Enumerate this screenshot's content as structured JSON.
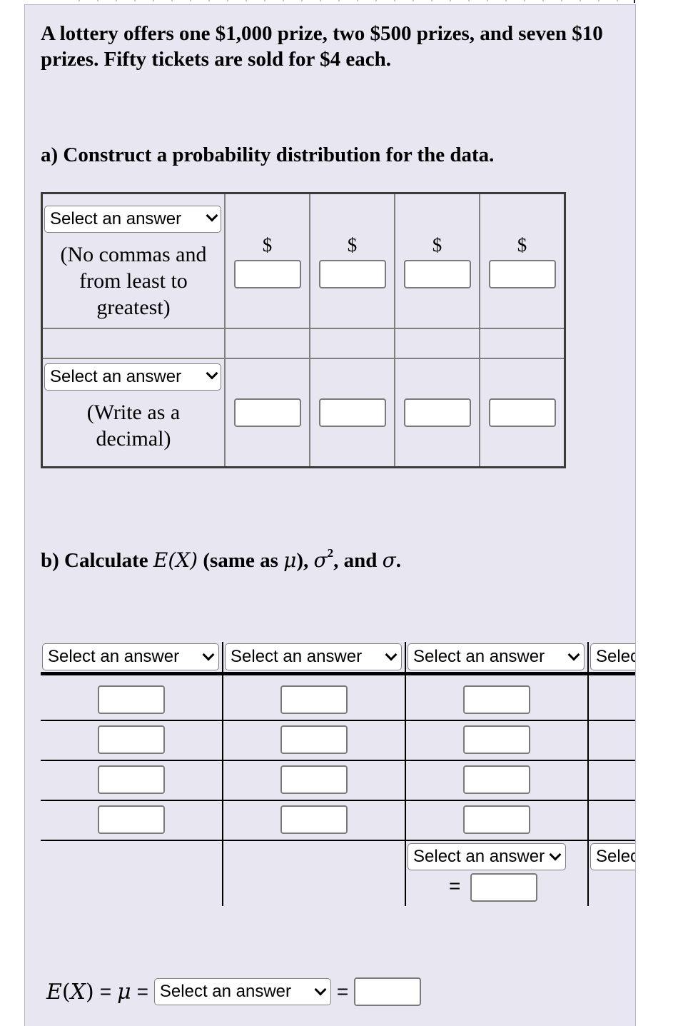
{
  "question": {
    "text": "A lottery offers one $1,000 prize, two $500 prizes, and seven $10 prizes. Fifty tickets are sold for $4 each.",
    "part_a": "a) Construct a probability distribution for the data.",
    "part_b": {
      "prefix": "b) Calculate ",
      "ex": "E(X)",
      "middle": " (same as ",
      "mu": "μ",
      "after_mu": "), ",
      "sigma": "σ",
      "squared": "2",
      "and": ", and ",
      "end": "."
    }
  },
  "select_placeholder": "Select an answer",
  "table_a": {
    "row1": {
      "select": "Select an answer",
      "hint": "(No commas and from least to greatest)",
      "prefix": "$",
      "inputs": [
        "",
        "",
        "",
        ""
      ]
    },
    "row3": {
      "select": "Select an answer",
      "hint": "(Write as a decimal)",
      "inputs": [
        "",
        "",
        "",
        ""
      ]
    }
  },
  "table_b": {
    "headers": [
      "Select an answer",
      "Select an answer",
      "Select an answer",
      "Select an answer"
    ],
    "rows": [
      [
        "",
        "",
        ""
      ],
      [
        "",
        "",
        ""
      ],
      [
        "",
        "",
        ""
      ],
      [
        "",
        "",
        ""
      ]
    ],
    "sum_select": "Select an answer",
    "sum_select_4": "Select an answer",
    "equals": "=",
    "sum_value": ""
  },
  "expected_value": {
    "label_e": "E",
    "label_x": "X",
    "mu": "μ",
    "equals": "=",
    "select": "Select an answer",
    "value": ""
  }
}
